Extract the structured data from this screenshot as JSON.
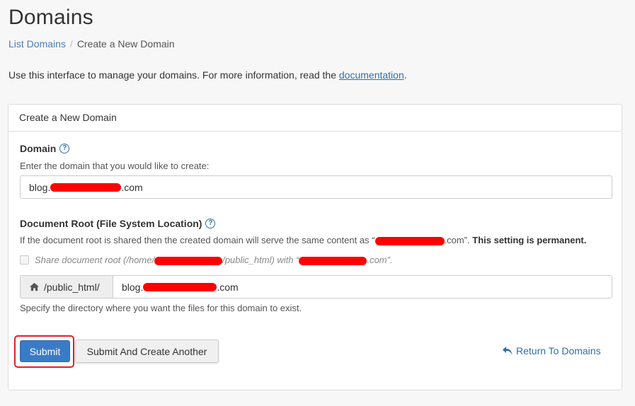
{
  "page": {
    "title": "Domains",
    "breadcrumb": {
      "link": "List Domains",
      "separator": "/",
      "current": "Create a New Domain"
    },
    "intro_prefix": "Use this interface to manage your domains. For more information, read the ",
    "intro_link": "documentation",
    "intro_suffix": "."
  },
  "panel": {
    "heading": "Create a New Domain",
    "domain": {
      "label": "Domain",
      "hint": "Enter the domain that you would like to create:",
      "value_prefix": "blog.",
      "value_suffix": ".com"
    },
    "docroot": {
      "label": "Document Root (File System Location)",
      "hint_prefix": "If the document root is shared then the created domain will serve the same content as “",
      "hint_mid": ".com”.",
      "hint_bold": "This setting is permanent.",
      "share_prefix": "Share document root (/home/",
      "share_mid": "/public_html) with “",
      "share_suffix": ".com”.",
      "addon": "/public_html/",
      "value_prefix": "blog.",
      "value_suffix": ".com",
      "footer_hint": "Specify the directory where you want the files for this domain to exist."
    },
    "buttons": {
      "submit": "Submit",
      "submit_another": "Submit And Create Another",
      "return": "Return To Domains"
    }
  },
  "colors": {
    "accent": "#3a7bc8",
    "link": "#2f6fad",
    "redaction": "#ff0000",
    "highlight": "#e02020"
  }
}
